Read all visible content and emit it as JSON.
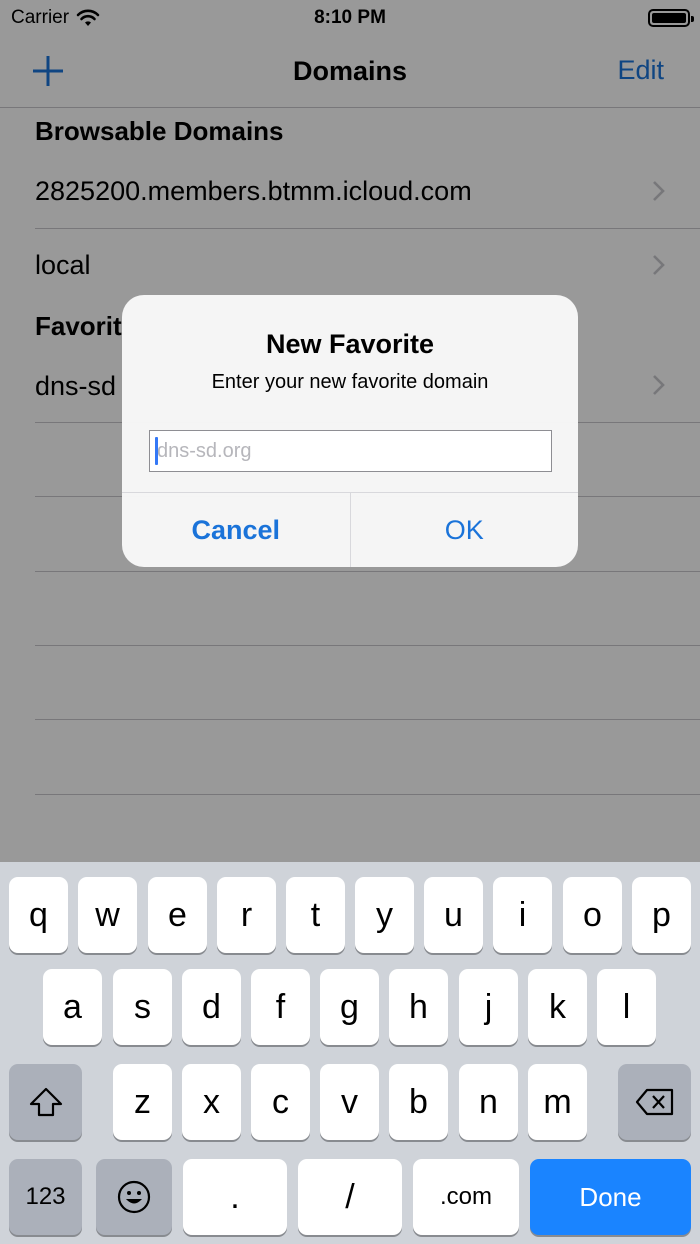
{
  "status": {
    "carrier": "Carrier",
    "time": "8:10 PM"
  },
  "nav": {
    "title": "Domains",
    "edit": "Edit"
  },
  "sections": {
    "browsable": {
      "header": "Browsable Domains",
      "rows": [
        "2825200.members.btmm.icloud.com",
        "local"
      ]
    },
    "favorites": {
      "header": "Favorit",
      "rows": [
        "dns-sd"
      ]
    }
  },
  "alert": {
    "title": "New Favorite",
    "message": "Enter your new favorite domain",
    "placeholder": "dns-sd.org",
    "cancel": "Cancel",
    "ok": "OK"
  },
  "keyboard": {
    "row1": [
      "q",
      "w",
      "e",
      "r",
      "t",
      "y",
      "u",
      "i",
      "o",
      "p"
    ],
    "row2": [
      "a",
      "s",
      "d",
      "f",
      "g",
      "h",
      "j",
      "k",
      "l"
    ],
    "row3": [
      "z",
      "x",
      "c",
      "v",
      "b",
      "n",
      "m"
    ],
    "numbers": "123",
    "dot": ".",
    "slash": "/",
    "dotcom": ".com",
    "done": "Done"
  }
}
